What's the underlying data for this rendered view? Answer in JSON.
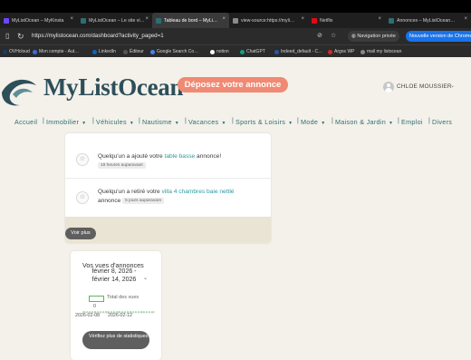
{
  "browser": {
    "tabs": [
      {
        "title": "MyListOcean – MyKinsta",
        "color": "#6c47ff"
      },
      {
        "title": "MyListOcean – Le site vi…",
        "color": "#2d6e73"
      },
      {
        "title": "Tableau de bord – MyLi…",
        "color": "#2d6e73",
        "active": true
      },
      {
        "title": "view-source:https://myli…",
        "color": "#8a8a8a"
      },
      {
        "title": "Netflix",
        "color": "#e50914"
      },
      {
        "title": "Annonces – MyListOcean…",
        "color": "#2d6e73"
      }
    ],
    "url": "https://mylistocean.com/dashboard?activity_paged=1",
    "private_label": "Navigation privée",
    "new_version_label": "Nouvelle version de Chrome",
    "bookmarks": [
      {
        "label": "OVHcloud",
        "color": "#123f6d"
      },
      {
        "label": "Mon compte - Aut…",
        "color": "#3b6fd6"
      },
      {
        "label": "LinkedIn",
        "color": "#0a66c2"
      },
      {
        "label": "Éditeur",
        "color": "#555555"
      },
      {
        "label": "Google Search Co…",
        "color": "#4285f4"
      },
      {
        "label": "notion",
        "color": "#ffffff"
      },
      {
        "label": "ChatGPT",
        "color": "#10a37f"
      },
      {
        "label": "Indeed_default - C…",
        "color": "#2557a7"
      },
      {
        "label": "Argos WP",
        "color": "#d62828"
      },
      {
        "label": "mail my listocean",
        "color": "#888888"
      }
    ]
  },
  "header": {
    "logo_text": "MyListOcean",
    "cta_label": "Déposez votre annonce",
    "user_name": "CHLOE MOUSSIER"
  },
  "menu": [
    {
      "label": "Accueil",
      "caret": false
    },
    {
      "label": "Immobilier",
      "caret": true
    },
    {
      "label": "Véhicules",
      "caret": true
    },
    {
      "label": "Nautisme",
      "caret": true
    },
    {
      "label": "Vacances",
      "caret": true
    },
    {
      "label": "Sports & Loisirs",
      "caret": true
    },
    {
      "label": "Mode",
      "caret": true
    },
    {
      "label": "Maison & Jardin",
      "caret": true
    },
    {
      "label": "Emploi",
      "caret": false
    },
    {
      "label": "Divers",
      "caret": false
    }
  ],
  "activity": {
    "items": [
      {
        "prefix": "Quelqu'un a ajouté votre ",
        "link": "table basse",
        "suffix": " annonce!",
        "time": "19 heures auparavant"
      },
      {
        "prefix": "Quelqu'un a retiré votre ",
        "link": "villa 4 chambres baie nettlé",
        "suffix": "annonce",
        "time": "5 jours auparavant"
      }
    ],
    "see_more_label": "Voir plus"
  },
  "stats": {
    "title": "Vos vues d'annonces",
    "range": "février 8, 2026 - février 14, 2026",
    "legend": "Total des vues",
    "y_tick": "0",
    "btn_label": "Vérifiez plus de statistiques"
  },
  "chart_data": {
    "type": "line",
    "title": "Vos vues d'annonces",
    "x": [
      "2026-02-08",
      "2026-02-09",
      "2026-02-10",
      "2026-02-11",
      "2026-02-12",
      "2026-02-13",
      "2026-02-14"
    ],
    "x_tick_labels": [
      "2026-02-08",
      "2026-02-12"
    ],
    "series": [
      {
        "name": "Total des vues",
        "values": [
          0,
          0,
          0,
          0,
          0,
          0,
          0
        ],
        "color": "#5cb85c"
      }
    ],
    "yticks": [
      "0"
    ]
  },
  "colors": {
    "brand": "#2d4f5a",
    "accent": "#f08a74",
    "link": "#2a9aa0",
    "menu": "#2d6e73"
  }
}
